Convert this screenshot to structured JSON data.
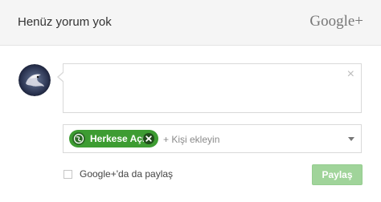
{
  "header": {
    "title": "Henüz yorum yok",
    "brand": "Google+"
  },
  "avatar": {
    "icon": "dragon-avatar"
  },
  "comment": {
    "value": "",
    "close_glyph": "×"
  },
  "share": {
    "chip_label": "Herkese Açık",
    "chip_icon": "globe-icon",
    "chip_color": "#3d9c32",
    "add_people_text": "+ Kişi ekleyin"
  },
  "footer": {
    "checkbox_checked": false,
    "checkbox_label": "Google+'da da paylaş",
    "share_button_label": "Paylaş",
    "share_button_color": "#a0d49a"
  }
}
